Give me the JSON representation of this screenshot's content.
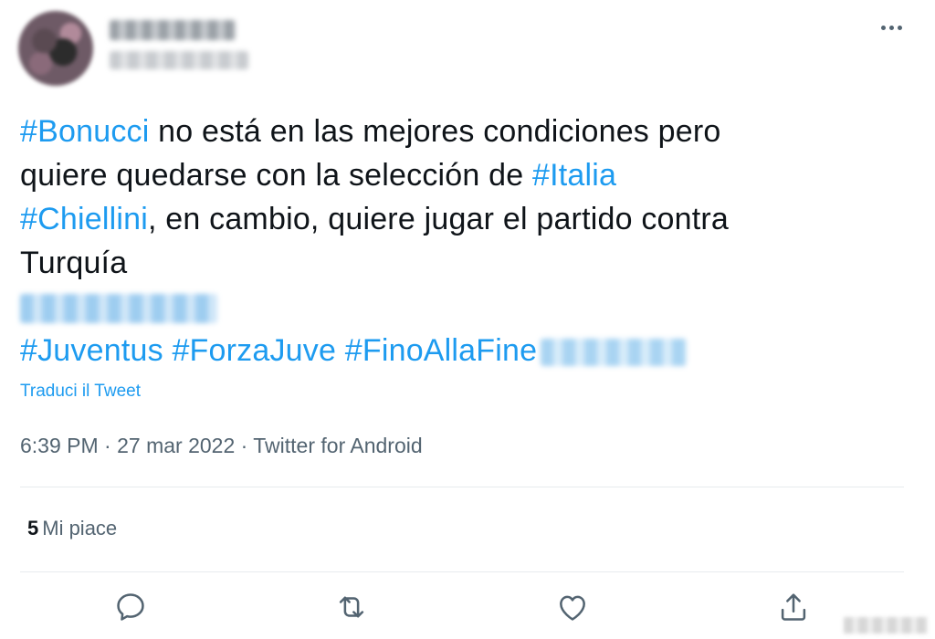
{
  "tweet": {
    "author": {
      "avatar_icon": "avatar-icon"
    },
    "text": {
      "hashtag_bonucci": "#Bonucci",
      "line1_rest": " no está en las mejores condiciones pero",
      "line2_text": "quiere quedarse con la selección de ",
      "hashtag_italia": "#Italia",
      "hashtag_chiellini": "#Chiellini",
      "line3_rest": ", en cambio, quiere jugar el partido contra",
      "line4_text": "Turquía",
      "hashtag_juventus": "#Juventus",
      "hashtag_forzajuve": "#ForzaJuve",
      "hashtag_finoallafine": "#FinoAllaFine"
    },
    "translate_label": "Traduci il Tweet",
    "meta": {
      "time": "6:39 PM",
      "date": "27 mar 2022",
      "source": "Twitter for Android",
      "separator": " · "
    },
    "stats": {
      "likes_count": "5",
      "likes_label": "Mi piace"
    },
    "actions": {
      "reply_icon": "reply-icon",
      "retweet_icon": "retweet-icon",
      "like_icon": "heart-icon",
      "share_icon": "share-icon"
    },
    "colors": {
      "link": "#1d9bf0",
      "text": "#0f1419",
      "secondary": "#536471"
    }
  }
}
